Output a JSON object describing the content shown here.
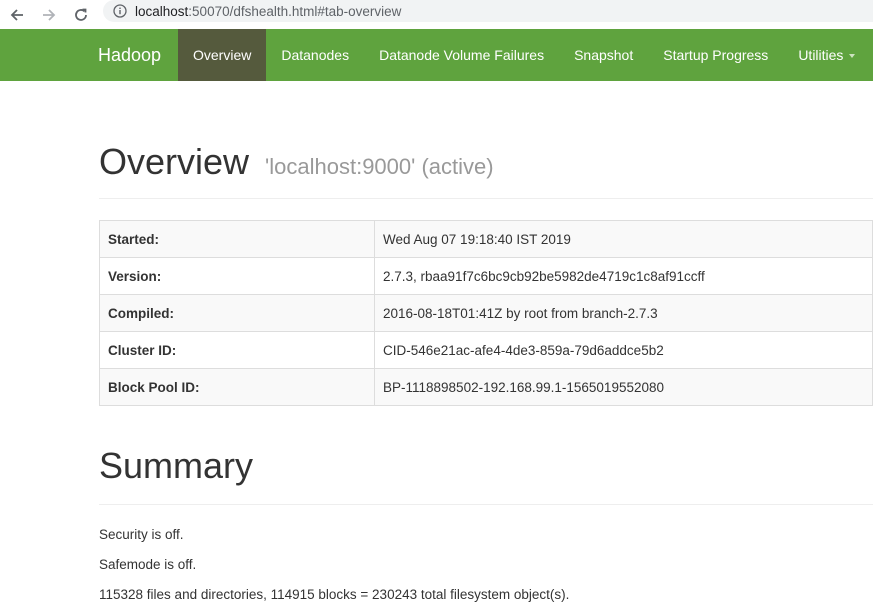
{
  "browser": {
    "url_host": "localhost",
    "url_rest": ":50070/dfshealth.html#tab-overview"
  },
  "navbar": {
    "brand": "Hadoop",
    "items": [
      {
        "label": "Overview",
        "active": true
      },
      {
        "label": "Datanodes",
        "active": false
      },
      {
        "label": "Datanode Volume Failures",
        "active": false
      },
      {
        "label": "Snapshot",
        "active": false
      },
      {
        "label": "Startup Progress",
        "active": false
      },
      {
        "label": "Utilities",
        "active": false,
        "dropdown": true
      }
    ]
  },
  "overview": {
    "title": "Overview",
    "subtitle": "'localhost:9000' (active)",
    "rows": [
      {
        "key": "Started:",
        "value": "Wed Aug 07 19:18:40 IST 2019"
      },
      {
        "key": "Version:",
        "value": "2.7.3, rbaa91f7c6bc9cb92be5982de4719c1c8af91ccff"
      },
      {
        "key": "Compiled:",
        "value": "2016-08-18T01:41Z by root from branch-2.7.3"
      },
      {
        "key": "Cluster ID:",
        "value": "CID-546e21ac-afe4-4de3-859a-79d6addce5b2"
      },
      {
        "key": "Block Pool ID:",
        "value": "BP-1118898502-192.168.99.1-1565019552080"
      }
    ]
  },
  "summary": {
    "title": "Summary",
    "security": "Security is off.",
    "safemode": "Safemode is off.",
    "objects": "115328 files and directories, 114915 blocks = 230243 total filesystem object(s)."
  },
  "colors": {
    "navbar": "#5fa33e",
    "navbar_active": "#555a3d"
  }
}
